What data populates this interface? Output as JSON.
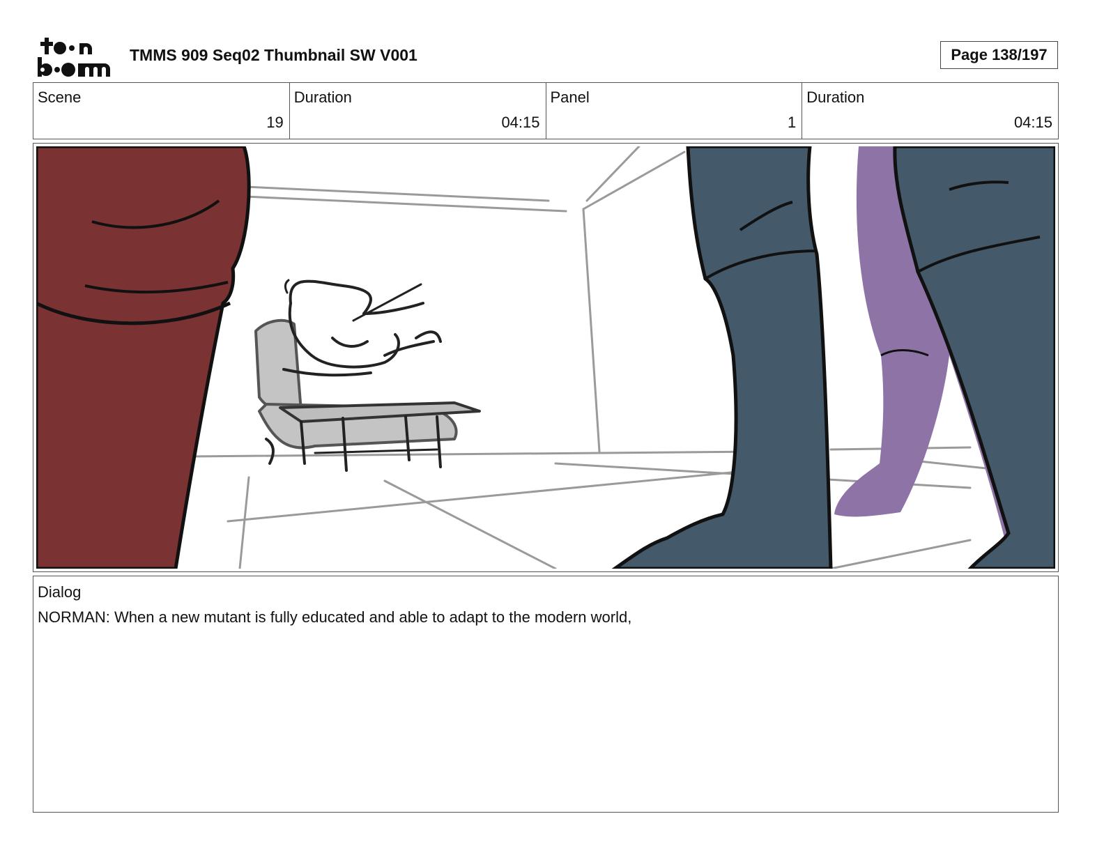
{
  "header": {
    "logo_text": "toonboom",
    "title": "TMMS 909 Seq02 Thumbnail SW V001",
    "page_label": "Page 138/197"
  },
  "info": {
    "scene": {
      "label": "Scene",
      "value": "19"
    },
    "scene_duration": {
      "label": "Duration",
      "value": "04:15"
    },
    "panel": {
      "label": "Panel",
      "value": "1"
    },
    "panel_duration": {
      "label": "Duration",
      "value": "04:15"
    }
  },
  "dialog": {
    "label": "Dialog",
    "text": "NORMAN: When a new mutant is fully educated and able to adapt to the modern world,"
  },
  "colors": {
    "red_character": "#7a3232",
    "teal_character": "#44596a",
    "purple_character": "#8e74a6",
    "line_gray": "#9a9a9a",
    "sketch_fill": "#c4c4c4"
  }
}
